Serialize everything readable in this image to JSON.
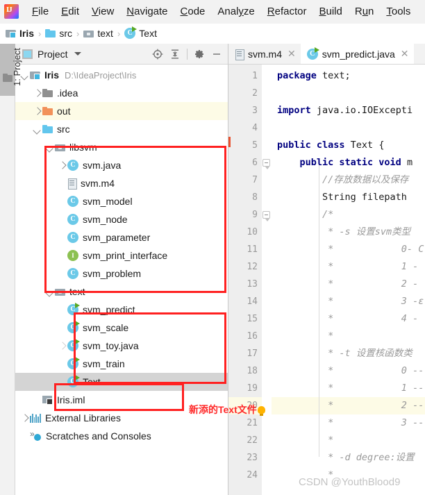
{
  "menu": {
    "logo_icon": "intellij-idea-logo",
    "items": [
      {
        "label": "File",
        "mnemonic": "F"
      },
      {
        "label": "Edit",
        "mnemonic": "E"
      },
      {
        "label": "View",
        "mnemonic": "V"
      },
      {
        "label": "Navigate",
        "mnemonic": "N"
      },
      {
        "label": "Code",
        "mnemonic": "C"
      },
      {
        "label": "Analyze",
        "mnemonic": "y"
      },
      {
        "label": "Refactor",
        "mnemonic": "R"
      },
      {
        "label": "Build",
        "mnemonic": "B"
      },
      {
        "label": "Run",
        "mnemonic": "u"
      },
      {
        "label": "Tools",
        "mnemonic": "T"
      }
    ]
  },
  "breadcrumb": {
    "separator": "›",
    "items": [
      {
        "label": "Iris",
        "icon": "module-folder-icon",
        "bold": true
      },
      {
        "label": "src",
        "icon": "source-folder-icon",
        "bold": false
      },
      {
        "label": "text",
        "icon": "package-folder-icon",
        "bold": false
      },
      {
        "label": "Text",
        "icon": "java-class-runnable-icon",
        "bold": false
      }
    ]
  },
  "toolwindow_strip": {
    "project_tab_label": "1: Project",
    "folder_icon": "folder-icon"
  },
  "project_panel": {
    "title": "Project",
    "title_icon": "project-view-icon",
    "dropdown_icon": "chevron-down-icon",
    "actions": [
      {
        "name": "locate-target-icon",
        "glyph": "⊕"
      },
      {
        "name": "collapse-all-icon",
        "glyph": "≡"
      },
      {
        "name": "settings-gear-icon",
        "glyph": "⚙"
      },
      {
        "name": "hide-panel-icon",
        "glyph": "—"
      }
    ],
    "tree": [
      {
        "indent": 0,
        "arrow": "down",
        "icon": "module-folder-icon",
        "label": "Iris",
        "bold": true,
        "path": "D:\\IdeaProject\\Iris",
        "state": "normal"
      },
      {
        "indent": 1,
        "arrow": "right",
        "icon": "gray-folder-icon",
        "label": ".idea",
        "bold": false,
        "path": "",
        "state": "normal"
      },
      {
        "indent": 1,
        "arrow": "right",
        "icon": "orange-folder-icon",
        "label": "out",
        "bold": false,
        "path": "",
        "state": "highlight"
      },
      {
        "indent": 1,
        "arrow": "down",
        "icon": "source-folder-icon",
        "label": "src",
        "bold": false,
        "path": "",
        "state": "normal"
      },
      {
        "indent": 2,
        "arrow": "down",
        "icon": "package-folder-icon",
        "label": "libsvm",
        "bold": false,
        "path": "",
        "state": "normal"
      },
      {
        "indent": 3,
        "arrow": "right",
        "icon": "java-class-icon",
        "label": "svm.java",
        "bold": false,
        "path": "",
        "state": "normal"
      },
      {
        "indent": 3,
        "arrow": "none",
        "icon": "text-file-icon",
        "label": "svm.m4",
        "bold": false,
        "path": "",
        "state": "normal"
      },
      {
        "indent": 3,
        "arrow": "none",
        "icon": "java-class-icon",
        "label": "svm_model",
        "bold": false,
        "path": "",
        "state": "normal"
      },
      {
        "indent": 3,
        "arrow": "none",
        "icon": "java-class-icon",
        "label": "svm_node",
        "bold": false,
        "path": "",
        "state": "normal"
      },
      {
        "indent": 3,
        "arrow": "none",
        "icon": "java-class-icon",
        "label": "svm_parameter",
        "bold": false,
        "path": "",
        "state": "normal"
      },
      {
        "indent": 3,
        "arrow": "none",
        "icon": "java-interface-icon",
        "label": "svm_print_interface",
        "bold": false,
        "path": "",
        "state": "normal"
      },
      {
        "indent": 3,
        "arrow": "none",
        "icon": "java-class-icon",
        "label": "svm_problem",
        "bold": false,
        "path": "",
        "state": "normal"
      },
      {
        "indent": 2,
        "arrow": "down",
        "icon": "package-folder-icon",
        "label": "text",
        "bold": false,
        "path": "",
        "state": "normal"
      },
      {
        "indent": 3,
        "arrow": "none",
        "icon": "java-class-runnable-icon",
        "label": "svm_predict",
        "bold": false,
        "path": "",
        "state": "normal"
      },
      {
        "indent": 3,
        "arrow": "none",
        "icon": "java-class-runnable-icon",
        "label": "svm_scale",
        "bold": false,
        "path": "",
        "state": "normal"
      },
      {
        "indent": 3,
        "arrow": "faint",
        "icon": "java-class-runnable-icon",
        "label": "svm_toy.java",
        "bold": false,
        "path": "",
        "state": "normal"
      },
      {
        "indent": 3,
        "arrow": "none",
        "icon": "java-class-runnable-icon",
        "label": "svm_train",
        "bold": false,
        "path": "",
        "state": "normal"
      },
      {
        "indent": 3,
        "arrow": "none",
        "icon": "java-class-runnable-icon",
        "label": "Text",
        "bold": false,
        "path": "",
        "state": "selected"
      },
      {
        "indent": 1,
        "arrow": "none",
        "icon": "iml-file-icon",
        "label": "Iris.iml",
        "bold": false,
        "path": "",
        "state": "normal"
      },
      {
        "indent": 0,
        "arrow": "right",
        "icon": "external-libraries-icon",
        "label": "External Libraries",
        "bold": false,
        "path": "",
        "state": "normal"
      },
      {
        "indent": 0,
        "arrow": "none",
        "icon": "scratches-icon",
        "label": "Scratches and Consoles",
        "bold": false,
        "path": "",
        "state": "normal"
      }
    ]
  },
  "editor": {
    "tabs": [
      {
        "label": "svm.m4",
        "icon": "text-file-icon",
        "active": false,
        "close_glyph": "✕"
      },
      {
        "label": "svm_predict.java",
        "icon": "java-class-runnable-icon",
        "active": true,
        "close_glyph": "✕"
      }
    ],
    "code_lines": [
      {
        "n": 1,
        "run": false,
        "fold": false,
        "hl": false,
        "tokens": [
          {
            "t": "kw",
            "v": "package"
          },
          {
            "t": "pln",
            "v": " text;"
          }
        ]
      },
      {
        "n": 2,
        "run": false,
        "fold": false,
        "hl": false,
        "tokens": []
      },
      {
        "n": 3,
        "run": false,
        "fold": false,
        "hl": false,
        "tokens": [
          {
            "t": "kw",
            "v": "import"
          },
          {
            "t": "pln",
            "v": " java.io.IOExcepti"
          }
        ]
      },
      {
        "n": 4,
        "run": false,
        "fold": false,
        "hl": false,
        "tokens": []
      },
      {
        "n": 5,
        "run": true,
        "fold": false,
        "hl": false,
        "tokens": [
          {
            "t": "kw",
            "v": "public class"
          },
          {
            "t": "pln",
            "v": " Text {"
          }
        ]
      },
      {
        "n": 6,
        "run": true,
        "fold": true,
        "hl": false,
        "tokens": [
          {
            "t": "pln",
            "v": "    "
          },
          {
            "t": "kw",
            "v": "public static void"
          },
          {
            "t": "pln",
            "v": " m"
          }
        ]
      },
      {
        "n": 7,
        "run": false,
        "fold": false,
        "hl": false,
        "tokens": [
          {
            "t": "cmt",
            "v": "        //存放数据以及保存"
          }
        ]
      },
      {
        "n": 8,
        "run": false,
        "fold": false,
        "hl": false,
        "tokens": [
          {
            "t": "pln",
            "v": "        String filepath"
          }
        ]
      },
      {
        "n": 9,
        "run": false,
        "fold": true,
        "hl": false,
        "tokens": [
          {
            "t": "cmt",
            "v": "        /*"
          }
        ]
      },
      {
        "n": 10,
        "run": false,
        "fold": false,
        "hl": false,
        "tokens": [
          {
            "t": "cmt",
            "v": "         * -s 设置svm类型"
          }
        ]
      },
      {
        "n": 11,
        "run": false,
        "fold": false,
        "hl": false,
        "tokens": [
          {
            "t": "cmt",
            "v": "         *            0- C"
          }
        ]
      },
      {
        "n": 12,
        "run": false,
        "fold": false,
        "hl": false,
        "tokens": [
          {
            "t": "cmt",
            "v": "         *            1 -"
          }
        ]
      },
      {
        "n": 13,
        "run": false,
        "fold": false,
        "hl": false,
        "tokens": [
          {
            "t": "cmt",
            "v": "         *            2 -"
          }
        ]
      },
      {
        "n": 14,
        "run": false,
        "fold": false,
        "hl": false,
        "tokens": [
          {
            "t": "cmt",
            "v": "         *            3 -ε"
          }
        ]
      },
      {
        "n": 15,
        "run": false,
        "fold": false,
        "hl": false,
        "tokens": [
          {
            "t": "cmt",
            "v": "         *            4 -"
          }
        ]
      },
      {
        "n": 16,
        "run": false,
        "fold": false,
        "hl": false,
        "tokens": [
          {
            "t": "cmt",
            "v": "         *"
          }
        ]
      },
      {
        "n": 17,
        "run": false,
        "fold": false,
        "hl": false,
        "tokens": [
          {
            "t": "cmt",
            "v": "         * -t 设置核函数类"
          }
        ]
      },
      {
        "n": 18,
        "run": false,
        "fold": false,
        "hl": false,
        "tokens": [
          {
            "t": "cmt",
            "v": "         *            0 --"
          }
        ]
      },
      {
        "n": 19,
        "run": false,
        "fold": false,
        "hl": false,
        "tokens": [
          {
            "t": "cmt",
            "v": "         *            1 --"
          }
        ]
      },
      {
        "n": 20,
        "run": false,
        "fold": false,
        "hl": true,
        "tokens": [
          {
            "t": "cmt",
            "v": "         *            2 --"
          }
        ]
      },
      {
        "n": 21,
        "run": false,
        "fold": false,
        "hl": false,
        "tokens": [
          {
            "t": "cmt",
            "v": "         *            3 --"
          }
        ]
      },
      {
        "n": 22,
        "run": false,
        "fold": false,
        "hl": false,
        "tokens": [
          {
            "t": "cmt",
            "v": "         *"
          }
        ]
      },
      {
        "n": 23,
        "run": false,
        "fold": false,
        "hl": false,
        "tokens": [
          {
            "t": "cmt",
            "v": "         * -d degree:设置"
          }
        ]
      },
      {
        "n": 24,
        "run": false,
        "fold": false,
        "hl": false,
        "tokens": [
          {
            "t": "cmt",
            "v": "         *"
          }
        ]
      }
    ]
  },
  "annotations": {
    "new_text_file_label": "新添的Text文件",
    "bulb_icon": "lightbulb-icon",
    "watermark": "CSDN @YouthBlood9",
    "highlight_color": "#ff2020"
  }
}
